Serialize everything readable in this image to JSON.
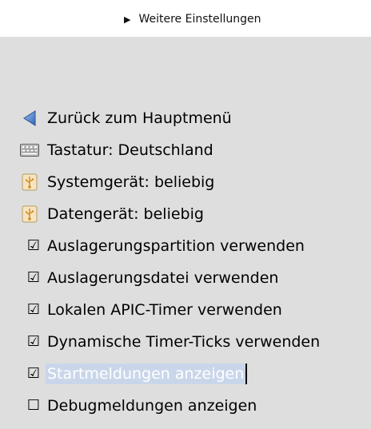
{
  "top_link": {
    "label": "Weitere Einstellungen",
    "icon": "triangle-right-icon"
  },
  "menu": {
    "items": [
      {
        "label": "Zurück zum Hauptmenü",
        "icon": "back-arrow-icon"
      },
      {
        "label": "Tastatur: Deutschland",
        "icon": "keyboard-icon"
      },
      {
        "label": "Systemgerät: beliebig",
        "icon": "usb-drive-icon"
      },
      {
        "label": "Datengerät: beliebig",
        "icon": "usb-drive-icon"
      },
      {
        "label": "Auslagerungspartition verwenden",
        "checked": true
      },
      {
        "label": "Auslagerungsdatei verwenden",
        "checked": true
      },
      {
        "label": "Lokalen APIC-Timer verwenden",
        "checked": true
      },
      {
        "label": "Dynamische Timer-Ticks verwenden",
        "checked": true
      },
      {
        "label": "Startmeldungen anzeigen",
        "checked": true,
        "selected": true
      },
      {
        "label": "Debugmeldungen anzeigen",
        "checked": false
      }
    ],
    "check_on": "☑",
    "check_off": "☐"
  },
  "colors": {
    "background": "#dedede",
    "top_bar": "#ffffff",
    "selection": "#c9d6ea",
    "back_arrow": "#3a74c8"
  }
}
